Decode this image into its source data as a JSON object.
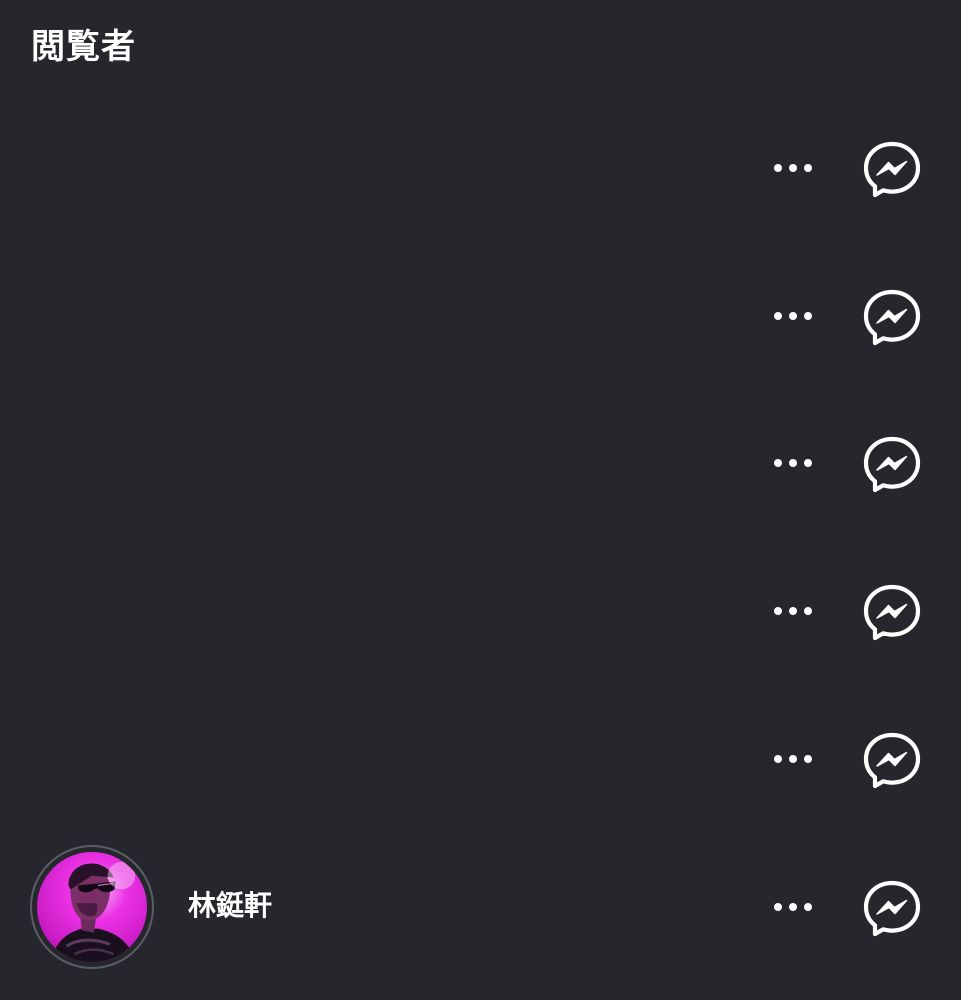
{
  "header": {
    "title": "閲覧者"
  },
  "viewers": [
    {
      "name": "",
      "has_avatar": false,
      "more_icon": "more-horizontal-icon",
      "message_icon": "messenger-icon"
    },
    {
      "name": "",
      "has_avatar": false,
      "more_icon": "more-horizontal-icon",
      "message_icon": "messenger-icon"
    },
    {
      "name": "",
      "has_avatar": false,
      "more_icon": "more-horizontal-icon",
      "message_icon": "messenger-icon"
    },
    {
      "name": "",
      "has_avatar": false,
      "more_icon": "more-horizontal-icon",
      "message_icon": "messenger-icon"
    },
    {
      "name": "",
      "has_avatar": false,
      "more_icon": "more-horizontal-icon",
      "message_icon": "messenger-icon"
    },
    {
      "name": "林鋌軒",
      "has_avatar": true,
      "more_icon": "more-horizontal-icon",
      "message_icon": "messenger-icon"
    }
  ],
  "colors": {
    "background": "#25272d",
    "text": "#ffffff",
    "avatar_ring": "#5b5e66",
    "avatar_accent": "#e81ae0"
  }
}
